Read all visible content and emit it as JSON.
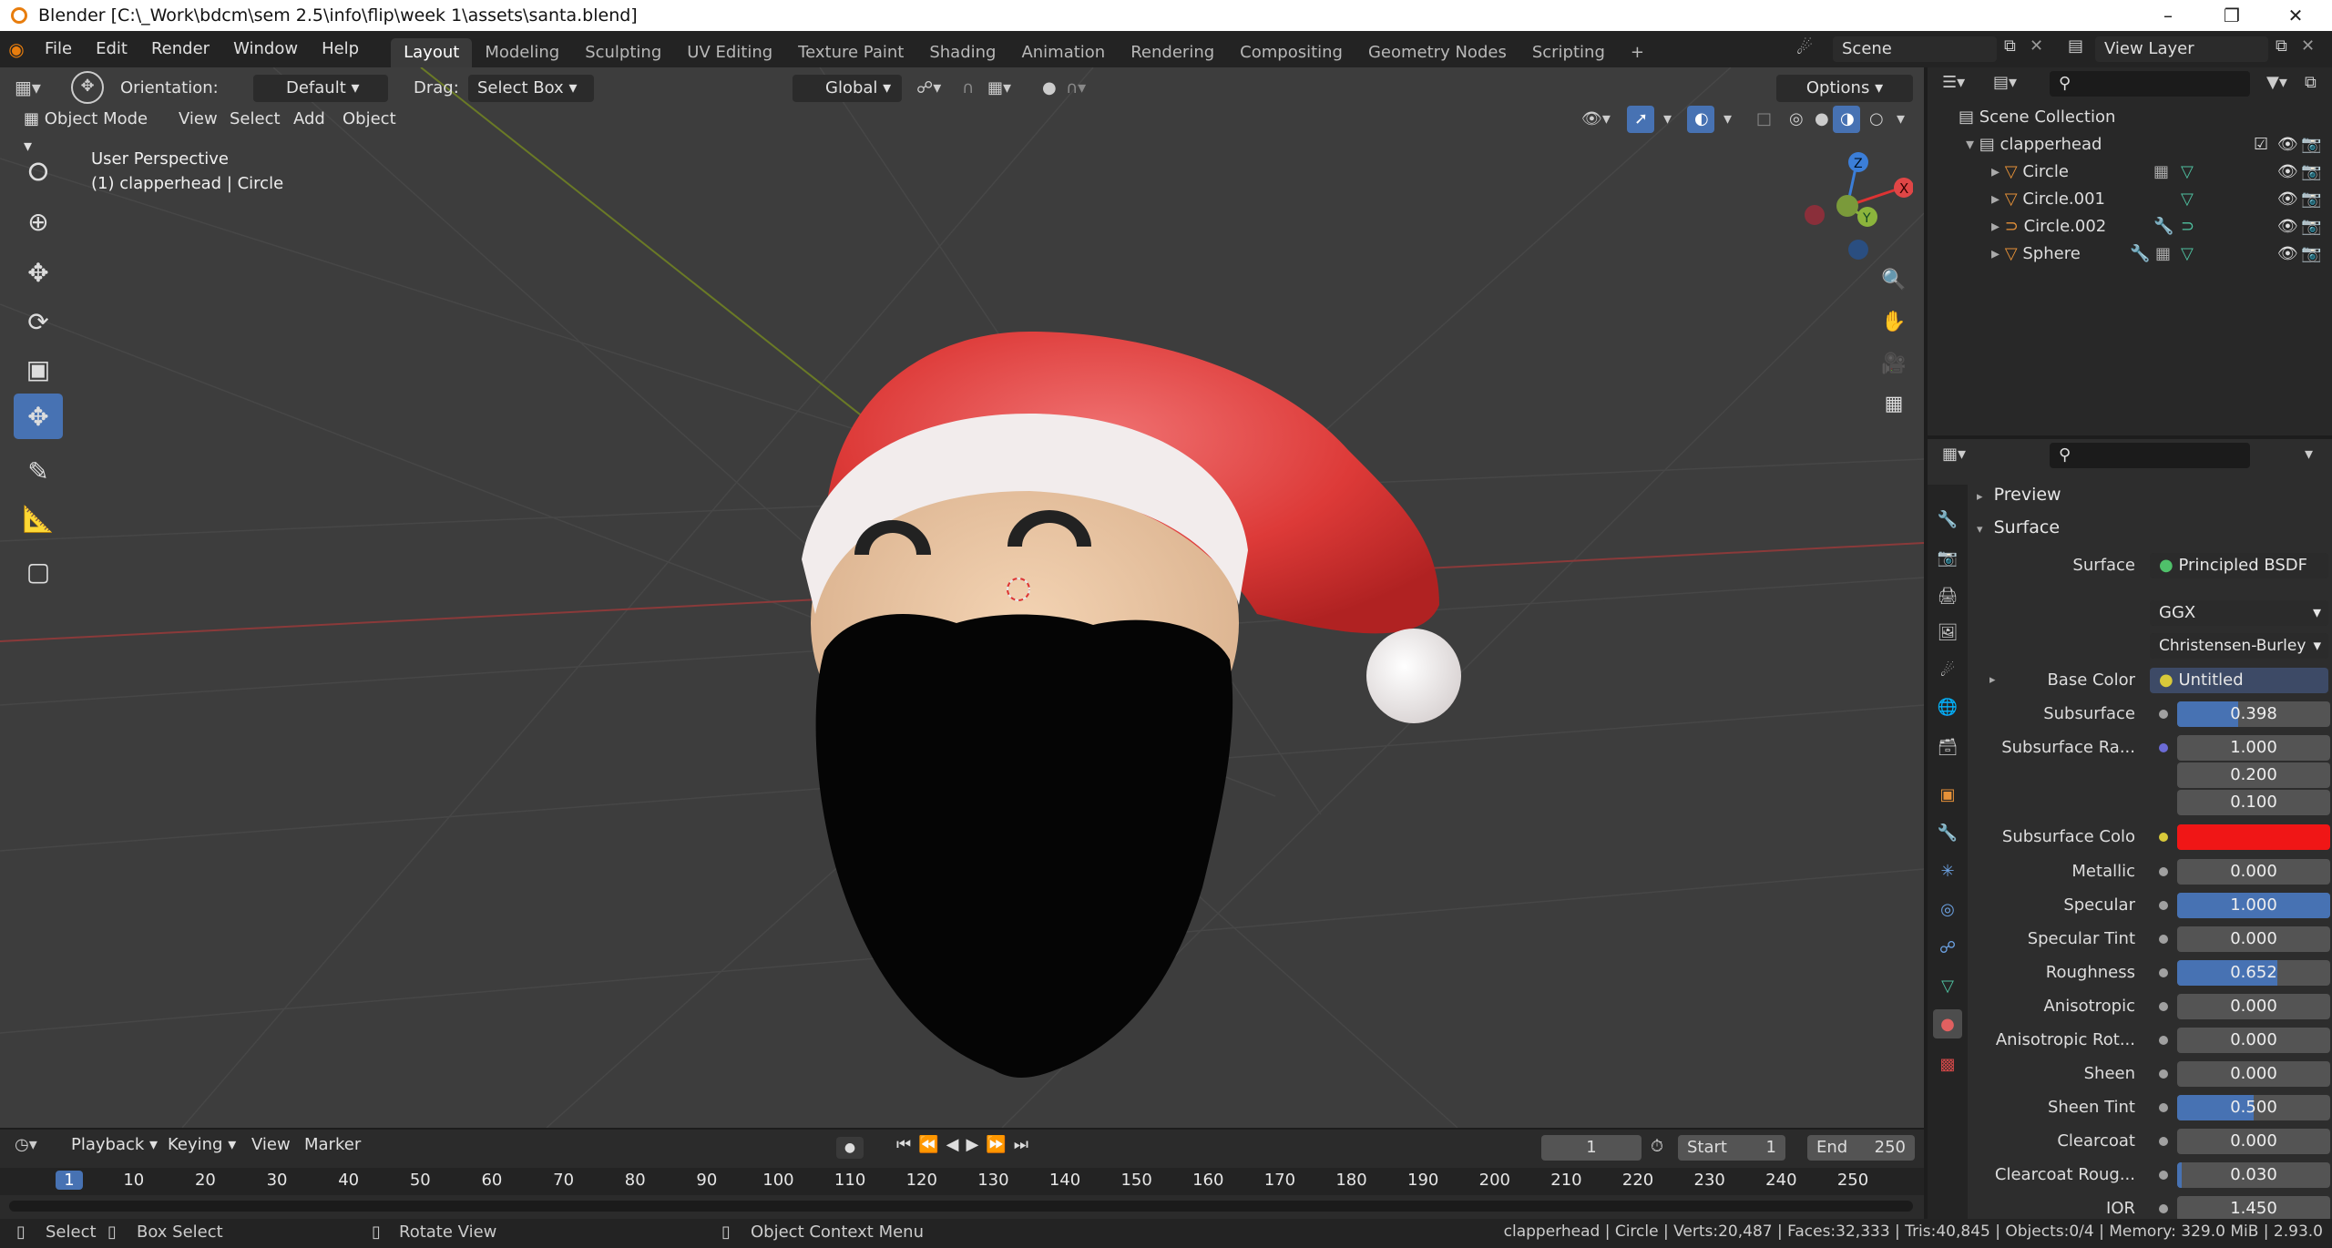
{
  "window": {
    "title": "Blender [C:\\_Work\\bdcm\\sem 2.5\\info\\flip\\week 1\\assets\\santa.blend]"
  },
  "menus": [
    "File",
    "Edit",
    "Render",
    "Window",
    "Help"
  ],
  "workspaces": [
    "Layout",
    "Modeling",
    "Sculpting",
    "UV Editing",
    "Texture Paint",
    "Shading",
    "Animation",
    "Rendering",
    "Compositing",
    "Geometry Nodes",
    "Scripting"
  ],
  "scene": {
    "label": "Scene",
    "view_layer": "View Layer"
  },
  "tool_header": {
    "orientation_label": "Orientation:",
    "orientation_value": "Default",
    "drag_label": "Drag:",
    "drag_value": "Select Box",
    "transform": "Global",
    "options": "Options"
  },
  "viewport_header": {
    "mode": "Object Mode",
    "items": [
      "View",
      "Select",
      "Add",
      "Object"
    ]
  },
  "viewport": {
    "perspective": "User Perspective",
    "context": "(1) clapperhead | Circle"
  },
  "gizmo": {
    "x": "X",
    "y": "Y",
    "z": "Z"
  },
  "outliner": {
    "root": "Scene Collection",
    "collection": "clapperhead",
    "objects": [
      "Circle",
      "Circle.001",
      "Circle.002",
      "Sphere"
    ]
  },
  "properties": {
    "preview": "Preview",
    "surface_panel": "Surface",
    "surface_label": "Surface",
    "surface_value": "Principled BSDF",
    "distribution": "GGX",
    "sss_method": "Christensen-Burley",
    "base_color_label": "Base Color",
    "base_color_value": "Untitled",
    "subsurface_label": "Subsurface",
    "subsurface_value": "0.398",
    "subsurface_radius_label": "Subsurface Ra...",
    "subsurface_radius": [
      "1.000",
      "0.200",
      "0.100"
    ],
    "subsurface_color_label": "Subsurface Colo",
    "subsurface_color": "#f01616",
    "rows": [
      {
        "label": "Metallic",
        "value": "0.000",
        "fill": 0
      },
      {
        "label": "Specular",
        "value": "1.000",
        "fill": 1
      },
      {
        "label": "Specular Tint",
        "value": "0.000",
        "fill": 0
      },
      {
        "label": "Roughness",
        "value": "0.652",
        "fill": 0.652
      },
      {
        "label": "Anisotropic",
        "value": "0.000",
        "fill": 0
      },
      {
        "label": "Anisotropic Rot...",
        "value": "0.000",
        "fill": 0
      },
      {
        "label": "Sheen",
        "value": "0.000",
        "fill": 0
      },
      {
        "label": "Sheen Tint",
        "value": "0.500",
        "fill": 0.5
      },
      {
        "label": "Clearcoat",
        "value": "0.000",
        "fill": 0
      },
      {
        "label": "Clearcoat Roug...",
        "value": "0.030",
        "fill": 0.03
      },
      {
        "label": "IOR",
        "value": "1.450",
        "fill": 0
      }
    ]
  },
  "timeline": {
    "menus": [
      "Playback",
      "Keying",
      "View",
      "Marker"
    ],
    "current_frame": "1",
    "start_label": "Start",
    "start": "1",
    "end_label": "End",
    "end": "250",
    "ruler": [
      "1",
      "10",
      "20",
      "30",
      "40",
      "50",
      "60",
      "70",
      "80",
      "90",
      "100",
      "110",
      "120",
      "130",
      "140",
      "150",
      "160",
      "170",
      "180",
      "190",
      "200",
      "210",
      "220",
      "230",
      "240",
      "250"
    ]
  },
  "status": {
    "select": "Select",
    "box_select": "Box Select",
    "rotate": "Rotate View",
    "context_menu": "Object Context Menu",
    "info": "clapperhead | Circle | Verts:20,487 | Faces:32,333 | Tris:40,845 | Objects:0/4 | Memory: 329.0 MiB | 2.93.0"
  },
  "colors": {
    "accent": "#4772b3",
    "hat_red": "#e03a36",
    "fur_white": "#f2ecec",
    "skin": "#e9c6a4"
  }
}
